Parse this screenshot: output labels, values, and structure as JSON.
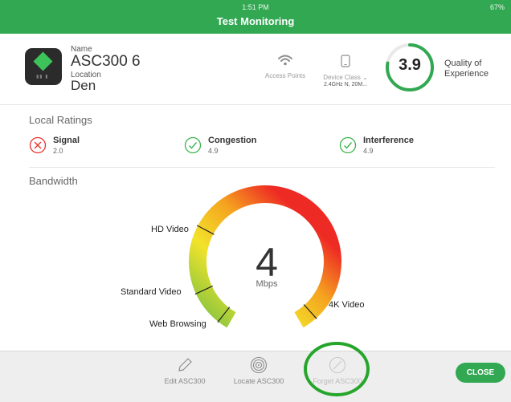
{
  "status": {
    "time": "1:51 PM",
    "battery": "67%"
  },
  "app": {
    "title": "Test Monitoring"
  },
  "device": {
    "name_label": "Name",
    "name": "ASC300 6",
    "location_label": "Location",
    "location": "Den",
    "access_points_label": "Access Points",
    "device_class_label": "Device Class",
    "device_class_value": "2.4GHz N, 20M..."
  },
  "qoe": {
    "score": "3.9",
    "label_line1": "Quality of",
    "label_line2": "Experience",
    "ring_fraction": 0.78
  },
  "local_ratings": {
    "title": "Local Ratings",
    "items": [
      {
        "name": "Signal",
        "score": "2.0",
        "status": "bad"
      },
      {
        "name": "Congestion",
        "score": "4.9",
        "status": "good"
      },
      {
        "name": "Interference",
        "score": "4.9",
        "status": "good"
      }
    ]
  },
  "bandwidth": {
    "title": "Bandwidth",
    "value": "4",
    "unit": "Mbps",
    "tiers": [
      "Web Browsing",
      "Standard Video",
      "HD Video",
      "4K Video"
    ]
  },
  "toolbar": {
    "edit_label": "Edit ASC300",
    "locate_label": "Locate ASC300",
    "forget_label": "Forget ASC300",
    "close_label": "CLOSE"
  },
  "colors": {
    "brand_green": "#33a853",
    "bad_red": "#e8332c",
    "good_green": "#3ab54a",
    "gauge_red": "#ee2a24",
    "gauge_yellow": "#f2e32a",
    "gauge_green": "#7dc242",
    "highlight_ring": "#26a52b"
  }
}
